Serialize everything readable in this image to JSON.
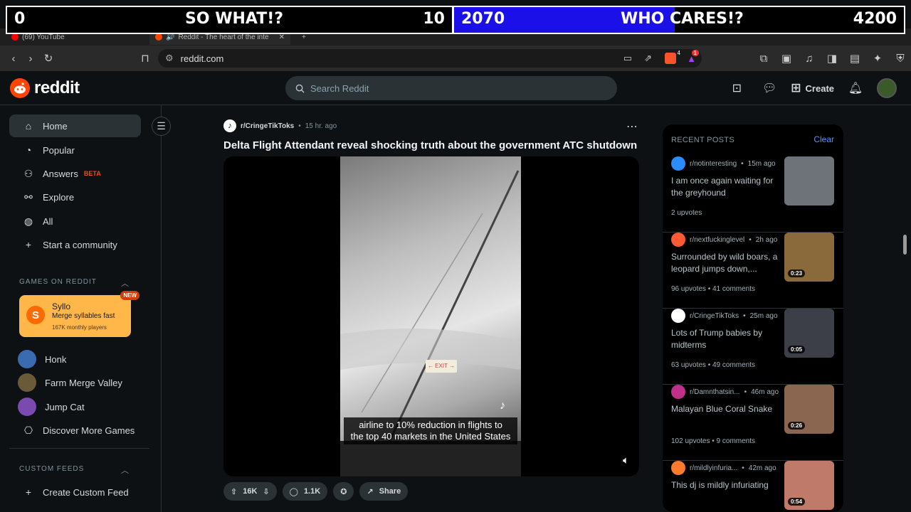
{
  "score": {
    "left_value": "0",
    "left_label": "SO WHAT!?",
    "left_target": "10",
    "right_value": "2070",
    "right_label": "WHO CARES!?",
    "right_target": "4200",
    "right_progress": 0.49
  },
  "browser": {
    "tabs": [
      {
        "label": "(69) YouTube",
        "active": false
      },
      {
        "label": "Reddit - The heart of the inte",
        "active": true
      }
    ],
    "url": "reddit.com",
    "shield_badge": "4",
    "alert_badge": "1"
  },
  "header": {
    "logo": "reddit",
    "search_placeholder": "Search Reddit",
    "create_label": "Create"
  },
  "sidebar": {
    "nav": [
      {
        "label": "Home",
        "icon": "home-icon",
        "active": true
      },
      {
        "label": "Popular",
        "icon": "popular-icon"
      },
      {
        "label": "Answers",
        "icon": "answers-icon",
        "badge": "BETA"
      },
      {
        "label": "Explore",
        "icon": "explore-icon"
      },
      {
        "label": "All",
        "icon": "all-icon"
      },
      {
        "label": "Start a community",
        "icon": "plus-icon"
      }
    ],
    "games_label": "GAMES ON REDDIT",
    "featured_game": {
      "name": "Syllo",
      "tagline": "Merge syllables fast",
      "players": "167K monthly players",
      "badge": "NEW"
    },
    "games": [
      "Honk",
      "Farm Merge Valley",
      "Jump Cat",
      "Discover More Games"
    ],
    "custom_feeds_label": "CUSTOM FEEDS",
    "create_feed": "Create Custom Feed"
  },
  "post": {
    "subreddit": "r/CringeTikToks",
    "time": "15 hr. ago",
    "title": "Delta Flight Attendant reveal shocking truth about the government ATC shutdown",
    "caption_line1": "airline to 10% reduction in flights to",
    "caption_line2": "the top 40 markets in the United States",
    "exit_sign": "← EXIT →",
    "upvotes": "16K",
    "comments": "1.1K",
    "share": "Share"
  },
  "recent": {
    "title": "RECENT POSTS",
    "clear": "Clear",
    "items": [
      {
        "sub": "r/notinteresting",
        "time": "15m ago",
        "title": "I am once again waiting for the greyhound",
        "stats": "2 upvotes",
        "duration": "",
        "icon_color": "#2a8cff",
        "thumb_color": "#6d7378"
      },
      {
        "sub": "r/nextfuckinglevel",
        "time": "2h ago",
        "title": "Surrounded by wild boars, a leopard jumps down,...",
        "stats": "96 upvotes  •  41 comments",
        "duration": "0:23",
        "icon_color": "#ff5a36",
        "thumb_color": "#8a6a3a"
      },
      {
        "sub": "r/CringeTikToks",
        "time": "25m ago",
        "title": "Lots of Trump babies by midterms",
        "stats": "63 upvotes  •  49 comments",
        "duration": "0:05",
        "icon_color": "#ffffff",
        "thumb_color": "#3d3f48"
      },
      {
        "sub": "r/Damnthatsin...",
        "time": "46m ago",
        "title": "Malayan Blue Coral Snake",
        "stats": "102 upvotes  •  9 comments",
        "duration": "0:26",
        "icon_color": "#c0308a",
        "thumb_color": "#8a6550"
      },
      {
        "sub": "r/mildlyinfuria...",
        "time": "42m ago",
        "title": "This dj is mildly infuriating",
        "stats": "",
        "duration": "0:54",
        "icon_color": "#ff7a2a",
        "thumb_color": "#c07a6a"
      }
    ]
  }
}
